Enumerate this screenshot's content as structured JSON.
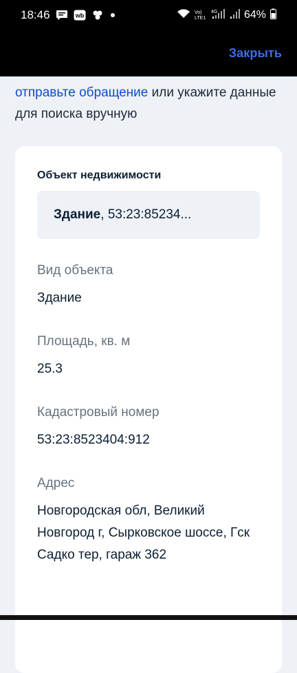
{
  "status_bar": {
    "time": "18:46",
    "network_small": "Vo)\nLTE1",
    "network_4g": "4G",
    "battery": "64%"
  },
  "header": {
    "close_label": "Закрыть"
  },
  "intro": {
    "link_text": "отправьте обращение",
    "rest_text": " или укажите данные для поиска вручную"
  },
  "card": {
    "title": "Объект недвижимости",
    "selected_kind": "Здание",
    "selected_rest": ", 53:23:85234...",
    "fields": [
      {
        "label": "Вид объекта",
        "value": "Здание"
      },
      {
        "label": "Площадь, кв. м",
        "value": "25.3"
      },
      {
        "label": "Кадастровый номер",
        "value": "53:23:8523404:912"
      },
      {
        "label": "Адрес",
        "value": "Новгородская обл, Великий Новгород г, Сырковское шоссе, Гск Садко тер, гараж 362"
      }
    ]
  }
}
